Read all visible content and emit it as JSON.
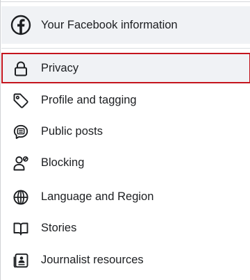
{
  "facebook_info": {
    "label": "Your Facebook information",
    "icon": "facebook-icon"
  },
  "menu": {
    "items": [
      {
        "label": "Privacy",
        "icon": "lock-icon",
        "selected": true
      },
      {
        "label": "Profile and tagging",
        "icon": "tag-icon",
        "selected": false
      },
      {
        "label": "Public posts",
        "icon": "speech-bubble-icon",
        "selected": false
      },
      {
        "label": "Blocking",
        "icon": "person-blocked-icon",
        "selected": false
      },
      {
        "label": "Language and Region",
        "icon": "globe-icon",
        "selected": false
      },
      {
        "label": "Stories",
        "icon": "book-icon",
        "selected": false
      },
      {
        "label": "Journalist resources",
        "icon": "id-card-icon",
        "selected": false
      }
    ]
  },
  "colors": {
    "selected_border": "#c4141d",
    "selected_background": "#f0f2f5",
    "text": "#1c1e21"
  }
}
